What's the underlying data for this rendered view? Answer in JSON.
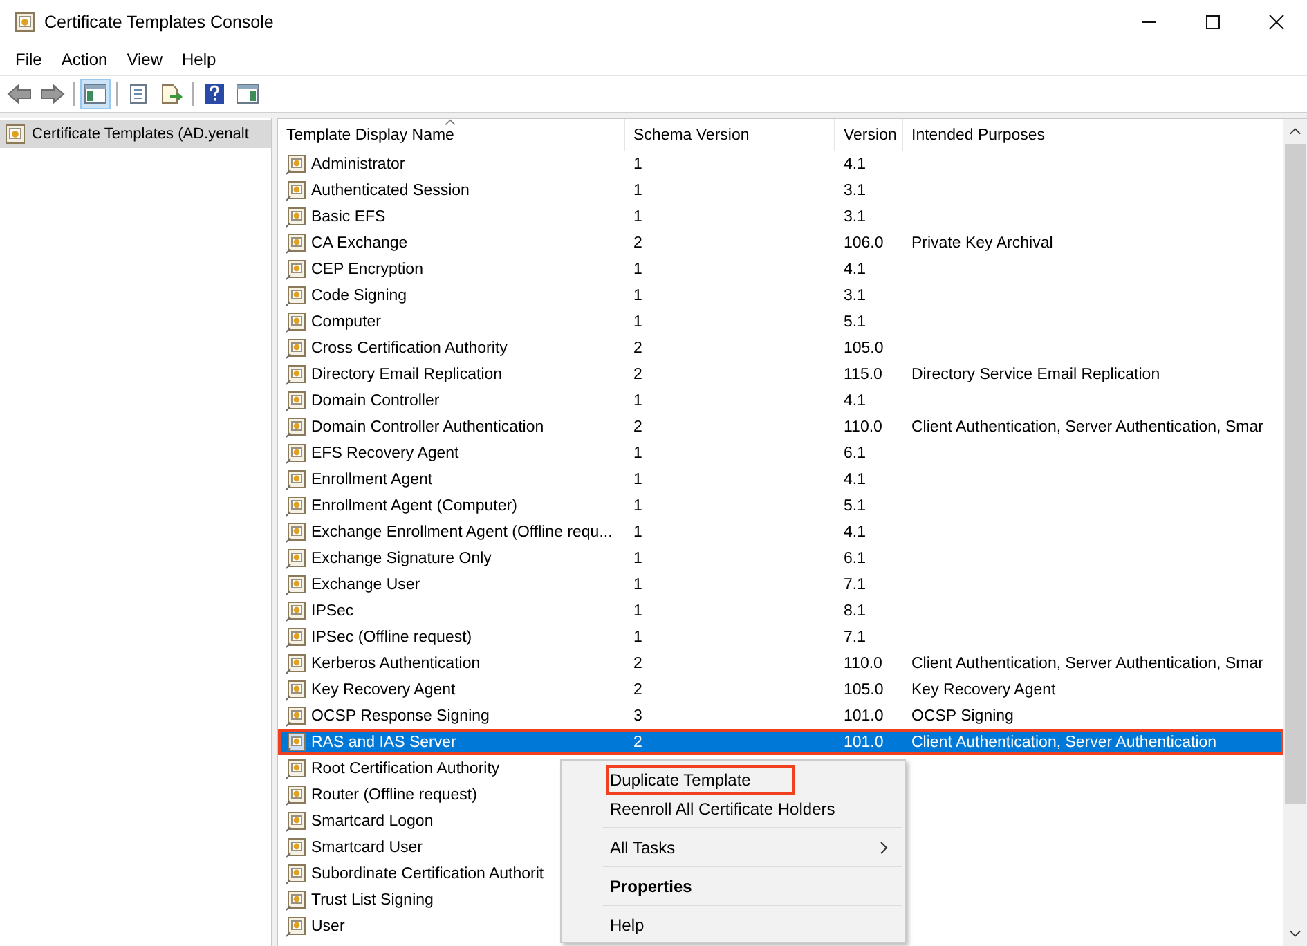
{
  "window": {
    "title": "Certificate Templates Console"
  },
  "menu": [
    "File",
    "Action",
    "View",
    "Help"
  ],
  "toolbar": [
    [
      {
        "kind": "back",
        "pressed": false
      },
      {
        "kind": "forward",
        "pressed": false
      }
    ],
    [
      {
        "kind": "tree",
        "pressed": true
      }
    ],
    [
      {
        "kind": "properties",
        "pressed": false
      },
      {
        "kind": "export",
        "pressed": false
      }
    ],
    [
      {
        "kind": "help",
        "pressed": false
      },
      {
        "kind": "actionpane",
        "pressed": false
      }
    ]
  ],
  "tree": {
    "items": [
      {
        "label": "Certificate Templates (AD.yenalt",
        "selected": true
      }
    ]
  },
  "table": {
    "columns": [
      {
        "label": "Template Display Name",
        "sorted": true
      },
      {
        "label": "Schema Version",
        "sorted": false
      },
      {
        "label": "Version",
        "sorted": false
      },
      {
        "label": "Intended Purposes",
        "sorted": false
      }
    ],
    "rows": [
      {
        "name": "Administrator",
        "schema": "1",
        "version": "4.1",
        "purposes": "",
        "selected": false,
        "highlighted": false
      },
      {
        "name": "Authenticated Session",
        "schema": "1",
        "version": "3.1",
        "purposes": "",
        "selected": false,
        "highlighted": false
      },
      {
        "name": "Basic EFS",
        "schema": "1",
        "version": "3.1",
        "purposes": "",
        "selected": false,
        "highlighted": false
      },
      {
        "name": "CA Exchange",
        "schema": "2",
        "version": "106.0",
        "purposes": "Private Key Archival",
        "selected": false,
        "highlighted": false
      },
      {
        "name": "CEP Encryption",
        "schema": "1",
        "version": "4.1",
        "purposes": "",
        "selected": false,
        "highlighted": false
      },
      {
        "name": "Code Signing",
        "schema": "1",
        "version": "3.1",
        "purposes": "",
        "selected": false,
        "highlighted": false
      },
      {
        "name": "Computer",
        "schema": "1",
        "version": "5.1",
        "purposes": "",
        "selected": false,
        "highlighted": false
      },
      {
        "name": "Cross Certification Authority",
        "schema": "2",
        "version": "105.0",
        "purposes": "",
        "selected": false,
        "highlighted": false
      },
      {
        "name": "Directory Email Replication",
        "schema": "2",
        "version": "115.0",
        "purposes": "Directory Service Email Replication",
        "selected": false,
        "highlighted": false
      },
      {
        "name": "Domain Controller",
        "schema": "1",
        "version": "4.1",
        "purposes": "",
        "selected": false,
        "highlighted": false
      },
      {
        "name": "Domain Controller Authentication",
        "schema": "2",
        "version": "110.0",
        "purposes": "Client Authentication, Server Authentication, Smar",
        "selected": false,
        "highlighted": false
      },
      {
        "name": "EFS Recovery Agent",
        "schema": "1",
        "version": "6.1",
        "purposes": "",
        "selected": false,
        "highlighted": false
      },
      {
        "name": "Enrollment Agent",
        "schema": "1",
        "version": "4.1",
        "purposes": "",
        "selected": false,
        "highlighted": false
      },
      {
        "name": "Enrollment Agent (Computer)",
        "schema": "1",
        "version": "5.1",
        "purposes": "",
        "selected": false,
        "highlighted": false
      },
      {
        "name": "Exchange Enrollment Agent (Offline requ...",
        "schema": "1",
        "version": "4.1",
        "purposes": "",
        "selected": false,
        "highlighted": false
      },
      {
        "name": "Exchange Signature Only",
        "schema": "1",
        "version": "6.1",
        "purposes": "",
        "selected": false,
        "highlighted": false
      },
      {
        "name": "Exchange User",
        "schema": "1",
        "version": "7.1",
        "purposes": "",
        "selected": false,
        "highlighted": false
      },
      {
        "name": "IPSec",
        "schema": "1",
        "version": "8.1",
        "purposes": "",
        "selected": false,
        "highlighted": false
      },
      {
        "name": "IPSec (Offline request)",
        "schema": "1",
        "version": "7.1",
        "purposes": "",
        "selected": false,
        "highlighted": false
      },
      {
        "name": "Kerberos Authentication",
        "schema": "2",
        "version": "110.0",
        "purposes": "Client Authentication, Server Authentication, Smar",
        "selected": false,
        "highlighted": false
      },
      {
        "name": "Key Recovery Agent",
        "schema": "2",
        "version": "105.0",
        "purposes": "Key Recovery Agent",
        "selected": false,
        "highlighted": false
      },
      {
        "name": "OCSP Response Signing",
        "schema": "3",
        "version": "101.0",
        "purposes": "OCSP Signing",
        "selected": false,
        "highlighted": false
      },
      {
        "name": "RAS and IAS Server",
        "schema": "2",
        "version": "101.0",
        "purposes": "Client Authentication, Server Authentication",
        "selected": true,
        "highlighted": true
      },
      {
        "name": "Root Certification Authority",
        "schema": "",
        "version": "",
        "purposes": "",
        "selected": false,
        "highlighted": false
      },
      {
        "name": "Router (Offline request)",
        "schema": "",
        "version": "",
        "purposes": "",
        "selected": false,
        "highlighted": false
      },
      {
        "name": "Smartcard Logon",
        "schema": "",
        "version": "",
        "purposes": "",
        "selected": false,
        "highlighted": false
      },
      {
        "name": "Smartcard User",
        "schema": "",
        "version": "",
        "purposes": "",
        "selected": false,
        "highlighted": false
      },
      {
        "name": "Subordinate Certification Authorit",
        "schema": "",
        "version": "",
        "purposes": "",
        "selected": false,
        "highlighted": false
      },
      {
        "name": "Trust List Signing",
        "schema": "",
        "version": "",
        "purposes": "",
        "selected": false,
        "highlighted": false
      },
      {
        "name": "User",
        "schema": "",
        "version": "",
        "purposes": "",
        "selected": false,
        "highlighted": false
      }
    ]
  },
  "context_menu": {
    "items": [
      {
        "kind": "item",
        "label": "Duplicate Template",
        "default": false,
        "submenu": false,
        "highlighted": true
      },
      {
        "kind": "item",
        "label": "Reenroll All Certificate Holders",
        "default": false,
        "submenu": false,
        "highlighted": false
      },
      {
        "kind": "separator"
      },
      {
        "kind": "item",
        "label": "All Tasks",
        "default": false,
        "submenu": true,
        "highlighted": false
      },
      {
        "kind": "separator"
      },
      {
        "kind": "item",
        "label": "Properties",
        "default": true,
        "submenu": false,
        "highlighted": false
      },
      {
        "kind": "separator"
      },
      {
        "kind": "item",
        "label": "Help",
        "default": false,
        "submenu": false,
        "highlighted": false
      }
    ]
  }
}
